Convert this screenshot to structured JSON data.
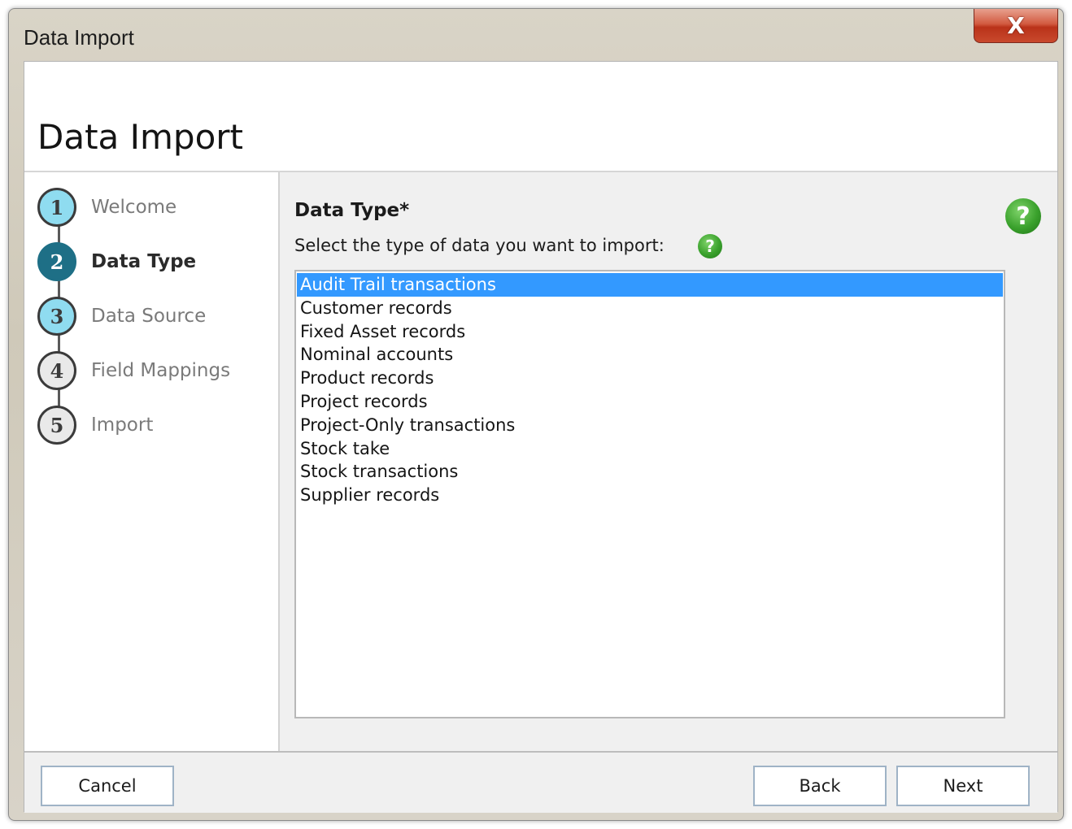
{
  "window": {
    "title": "Data Import",
    "close_glyph": "X"
  },
  "header": {
    "title": "Data Import"
  },
  "steps": [
    {
      "number": "1",
      "label": "Welcome",
      "state": "done"
    },
    {
      "number": "2",
      "label": "Data Type",
      "state": "current"
    },
    {
      "number": "3",
      "label": "Data Source",
      "state": "done"
    },
    {
      "number": "4",
      "label": "Field Mappings",
      "state": "pending"
    },
    {
      "number": "5",
      "label": "Import",
      "state": "pending"
    }
  ],
  "content": {
    "field_title": "Data Type*",
    "field_description": "Select the type of data you want to import:",
    "help_glyph": "?",
    "selected_index": 0,
    "items": [
      "Audit Trail transactions",
      "Customer records",
      "Fixed Asset records",
      "Nominal accounts",
      "Product records",
      "Project records",
      "Project-Only transactions",
      "Stock take",
      "Stock transactions",
      "Supplier records"
    ]
  },
  "footer": {
    "cancel_label": "Cancel",
    "back_label": "Back",
    "next_label": "Next"
  },
  "colors": {
    "selection": "#3399ff",
    "step_done": "#8fdcf0",
    "step_current": "#1e6f86",
    "help_green": "#3aa12c",
    "close_red": "#c9492d"
  }
}
